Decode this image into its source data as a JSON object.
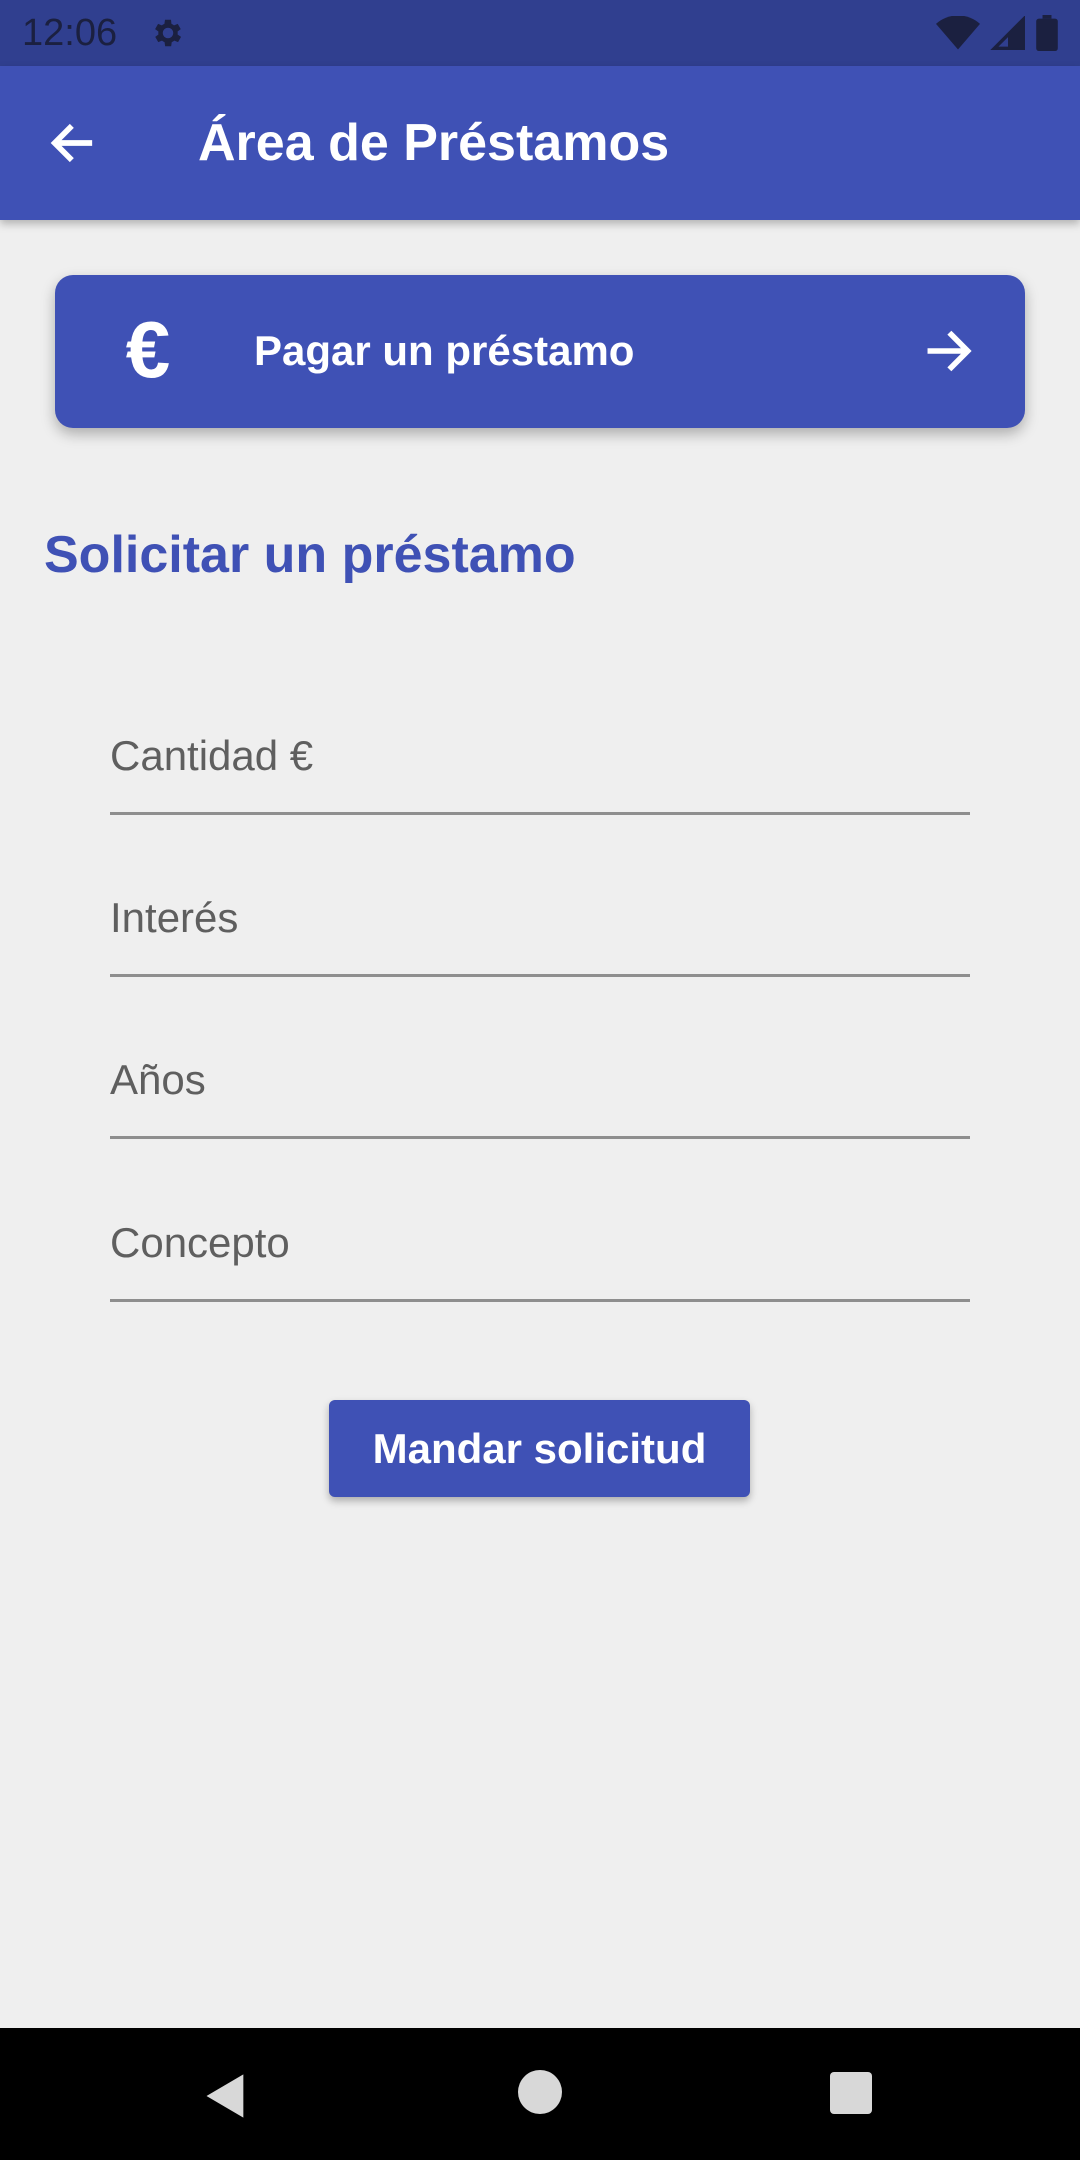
{
  "status_bar": {
    "time": "12:06",
    "icons": [
      "gear-icon",
      "wifi-icon",
      "signal-icon",
      "battery-icon"
    ]
  },
  "app_bar": {
    "title": "Área de Préstamos",
    "back_icon": "arrow-left-icon"
  },
  "pay_card": {
    "icon": "euro-icon",
    "icon_glyph": "€",
    "label": "Pagar un préstamo",
    "arrow_icon": "arrow-right-icon"
  },
  "request_section": {
    "title": "Solicitar un préstamo",
    "fields": [
      {
        "placeholder": "Cantidad €",
        "value": ""
      },
      {
        "placeholder": "Interés",
        "value": ""
      },
      {
        "placeholder": "Años",
        "value": ""
      },
      {
        "placeholder": "Concepto",
        "value": ""
      }
    ],
    "submit_label": "Mandar solicitud"
  },
  "nav_bar": {
    "icons": [
      "nav-back-icon",
      "nav-home-icon",
      "nav-recents-icon"
    ]
  },
  "colors": {
    "primary": "#3f51b5",
    "status_bar": "#303f8f",
    "background": "#efefef"
  }
}
